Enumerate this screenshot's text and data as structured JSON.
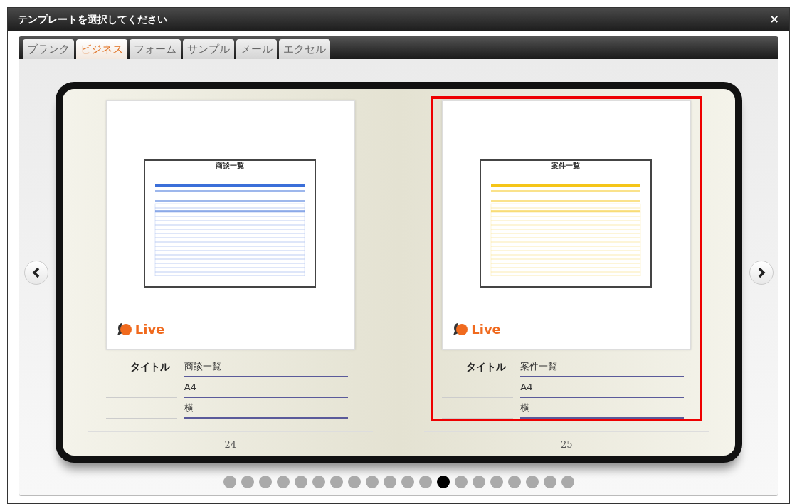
{
  "window": {
    "title": "テンプレートを選択してください",
    "close": "×"
  },
  "tabs": [
    {
      "label": "ブランク",
      "selected": false
    },
    {
      "label": "ビジネス",
      "selected": true
    },
    {
      "label": "フォーム",
      "selected": false
    },
    {
      "label": "サンプル",
      "selected": false
    },
    {
      "label": "メール",
      "selected": false
    },
    {
      "label": "エクセル",
      "selected": false
    }
  ],
  "pages": [
    {
      "thumbnail_title": "商談一覧",
      "color": "#3b6fd9",
      "logo": "Live",
      "fields": [
        {
          "label": "タイトル",
          "value": "商談一覧"
        },
        {
          "value": "A4"
        },
        {
          "value": "横"
        }
      ],
      "page_number": "24",
      "selected": false
    },
    {
      "thumbnail_title": "案件一覧",
      "color": "#f5c518",
      "logo": "Live",
      "fields": [
        {
          "label": "タイトル",
          "value": "案件一覧"
        },
        {
          "value": "A4"
        },
        {
          "value": "横"
        }
      ],
      "page_number": "25",
      "selected": true
    }
  ],
  "pager": [
    {
      "selected": false
    },
    {
      "selected": false
    },
    {
      "selected": false
    },
    {
      "selected": false
    },
    {
      "selected": false
    },
    {
      "selected": false
    },
    {
      "selected": false
    },
    {
      "selected": false
    },
    {
      "selected": false
    },
    {
      "selected": false
    },
    {
      "selected": false
    },
    {
      "selected": false
    },
    {
      "selected": true
    },
    {
      "selected": false
    },
    {
      "selected": false
    },
    {
      "selected": false
    },
    {
      "selected": false
    },
    {
      "selected": false
    },
    {
      "selected": false
    },
    {
      "selected": false
    }
  ]
}
